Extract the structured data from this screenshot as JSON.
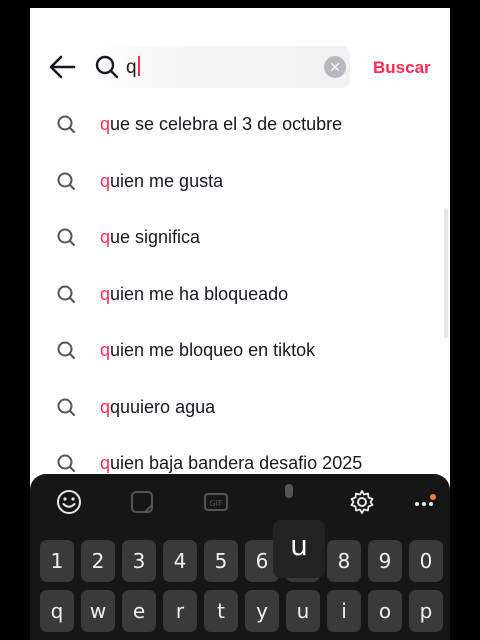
{
  "header": {
    "query": "q",
    "search_button": "Buscar"
  },
  "suggestions": [
    {
      "hl": "q",
      "rest": "ue se celebra el 3 de octubre"
    },
    {
      "hl": "q",
      "rest": "uien me gusta"
    },
    {
      "hl": "q",
      "rest": "ue significa"
    },
    {
      "hl": "q",
      "rest": "uien me ha bloqueado"
    },
    {
      "hl": "q",
      "rest": "uien me bloqueo en tiktok"
    },
    {
      "hl": "q",
      "rest": "quuiero agua"
    },
    {
      "hl": "q",
      "rest": "uien baja bandera desafio 2025"
    }
  ],
  "keyboard": {
    "toolbar_icons": [
      "emoji-icon",
      "sticker-icon",
      "gif-icon",
      "mic-icon",
      "settings-icon",
      "more-icon"
    ],
    "number_row": [
      "1",
      "2",
      "3",
      "4",
      "5",
      "6",
      "7",
      "8",
      "9",
      "0"
    ],
    "letter_row": [
      "q",
      "w",
      "e",
      "r",
      "t",
      "y",
      "u",
      "i",
      "o",
      "p"
    ],
    "pressed_key": "u"
  },
  "colors": {
    "accent": "#fe2c55",
    "keyboard_bg": "#161616",
    "key_bg": "#3a3a3a"
  }
}
